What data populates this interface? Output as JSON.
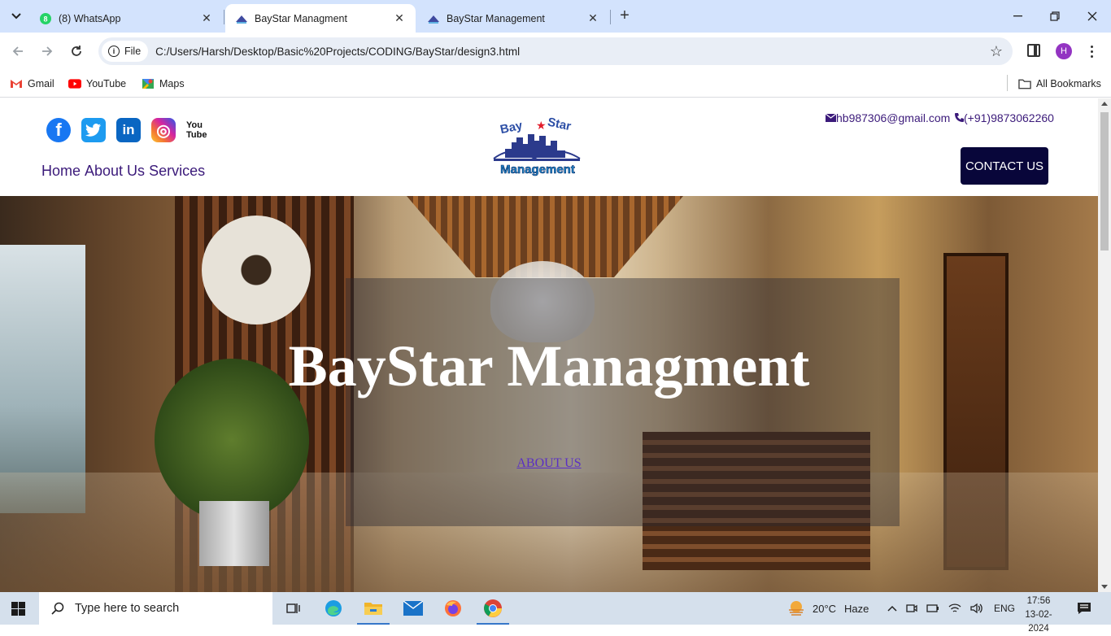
{
  "browser": {
    "tabs": [
      {
        "title": "(8) WhatsApp",
        "icon": "whatsapp-icon",
        "active": false
      },
      {
        "title": "BayStar Managment",
        "icon": "site-icon",
        "active": true
      },
      {
        "title": "BayStar Management",
        "icon": "site-icon",
        "active": false
      }
    ],
    "address": {
      "chip_label": "File",
      "url": "C:/Users/Harsh/Desktop/Basic%20Projects/CODING/BayStar/design3.html"
    },
    "profile_initial": "H",
    "bookmarks": [
      {
        "label": "Gmail",
        "icon": "gmail-icon"
      },
      {
        "label": "YouTube",
        "icon": "youtube-icon"
      },
      {
        "label": "Maps",
        "icon": "maps-icon"
      }
    ],
    "all_bookmarks_label": "All Bookmarks"
  },
  "site": {
    "social": [
      {
        "name": "facebook",
        "glyph": "f",
        "color": "#1877f2"
      },
      {
        "name": "twitter",
        "glyph": "t",
        "color": "#1d9bf0"
      },
      {
        "name": "linkedin",
        "glyph": "in",
        "color": "#0a66c2"
      },
      {
        "name": "instagram",
        "glyph": "◎",
        "color": "#d6249f"
      },
      {
        "name": "youtube",
        "glyph": "You Tube",
        "color": "#e62117"
      }
    ],
    "nav": [
      "Home",
      "About Us",
      "Services"
    ],
    "logo": {
      "line1": "Bay",
      "line2": "Star",
      "line3": "Management"
    },
    "contact": {
      "email": "hb987306@gmail.com",
      "phone": "(+91)9873062260",
      "button": "CONTACT US"
    },
    "hero": {
      "title": "BayStar Managment",
      "link": "ABOUT US"
    }
  },
  "taskbar": {
    "search_placeholder": "Type here to search",
    "weather": {
      "temp": "20°C",
      "condition": "Haze"
    },
    "language": "ENG",
    "time": "17:56",
    "date": "13-02-2024"
  }
}
